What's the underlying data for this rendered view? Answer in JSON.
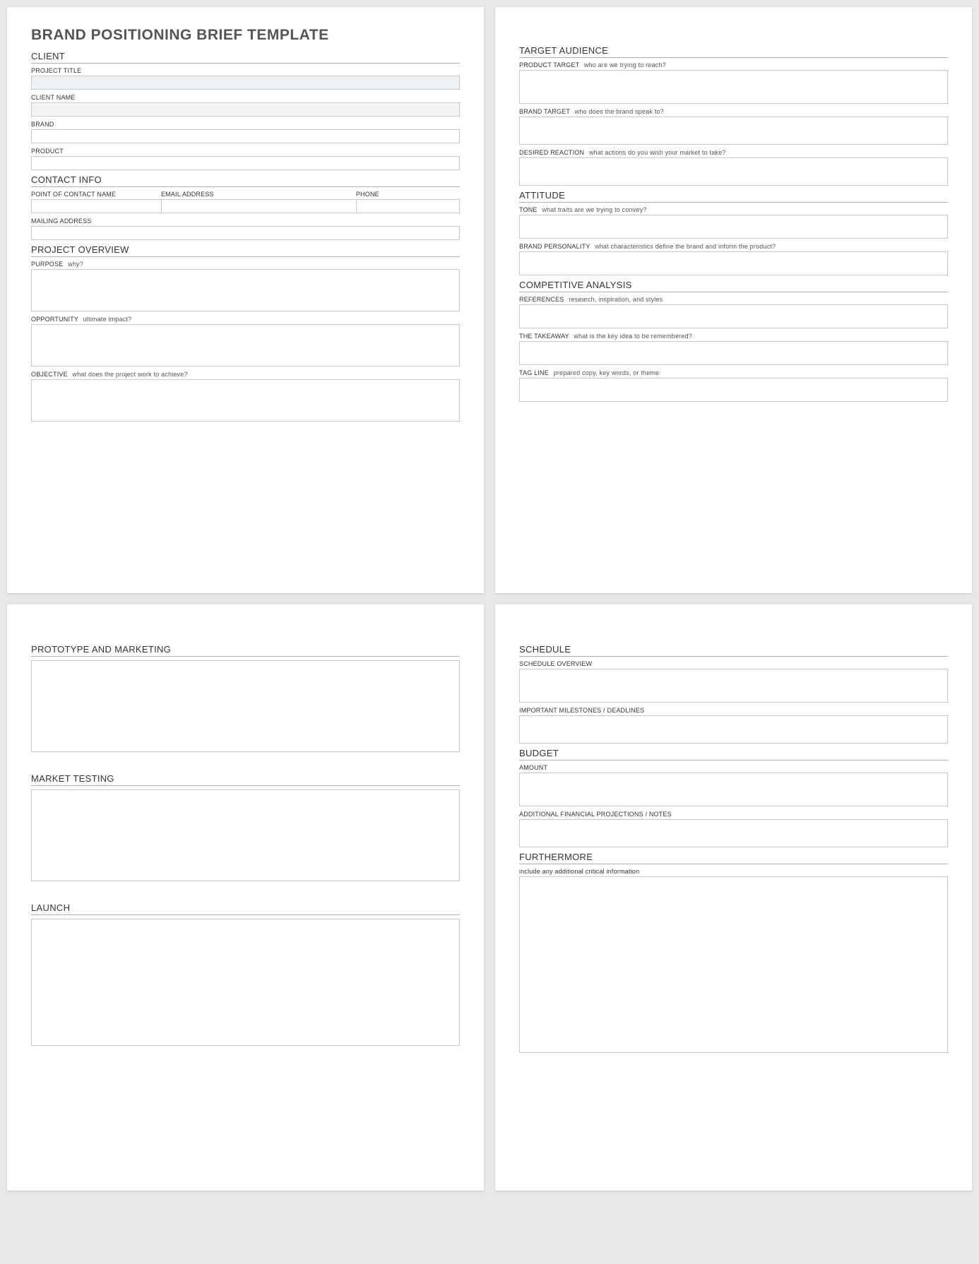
{
  "doc_title": "BRAND POSITIONING BRIEF TEMPLATE",
  "p1": {
    "client_header": "CLIENT",
    "project_title_label": "PROJECT TITLE",
    "client_name_label": "CLIENT NAME",
    "brand_label": "BRAND",
    "product_label": "PRODUCT",
    "contact_header": "CONTACT INFO",
    "poc_label": "POINT OF CONTACT NAME",
    "email_label": "EMAIL ADDRESS",
    "phone_label": "PHONE",
    "mailing_label": "MAILING ADDRESS",
    "overview_header": "PROJECT OVERVIEW",
    "purpose_label": "PURPOSE",
    "purpose_hint": "why?",
    "opportunity_label": "OPPORTUNITY",
    "opportunity_hint": "ultimate impact?",
    "objective_label": "OBJECTIVE",
    "objective_hint": "what does the project work to achieve?"
  },
  "p2": {
    "target_header": "TARGET AUDIENCE",
    "product_target_label": "PRODUCT TARGET",
    "product_target_hint": "who are we trying to reach?",
    "brand_target_label": "BRAND TARGET",
    "brand_target_hint": "who does the brand speak to?",
    "desired_label": "DESIRED REACTION",
    "desired_hint": "what actions do you wish your market to take?",
    "attitude_header": "ATTITUDE",
    "tone_label": "TONE",
    "tone_hint": "what traits are we trying to convey?",
    "personality_label": "BRAND PERSONALITY",
    "personality_hint": "what characteristics define the brand and inform the product?",
    "competitive_header": "COMPETITIVE ANALYSIS",
    "references_label": "REFERENCES",
    "references_hint": "research, inspiration, and styles",
    "takeaway_label": "THE TAKEAWAY",
    "takeaway_hint": "what is the key idea to be remembered?",
    "tagline_label": "TAG LINE",
    "tagline_hint": "prepared copy, key words, or theme"
  },
  "p3": {
    "proto_header": "PROTOTYPE AND MARKETING",
    "testing_header": "MARKET TESTING",
    "launch_header": "LAUNCH"
  },
  "p4": {
    "schedule_header": "SCHEDULE",
    "schedule_overview_label": "SCHEDULE OVERVIEW",
    "milestones_label": "IMPORTANT MILESTONES / DEADLINES",
    "budget_header": "BUDGET",
    "amount_label": "AMOUNT",
    "financial_label": "ADDITIONAL FINANCIAL PROJECTIONS / NOTES",
    "furthermore_header": "FURTHERMORE",
    "furthermore_hint": "include any additional critical information"
  }
}
